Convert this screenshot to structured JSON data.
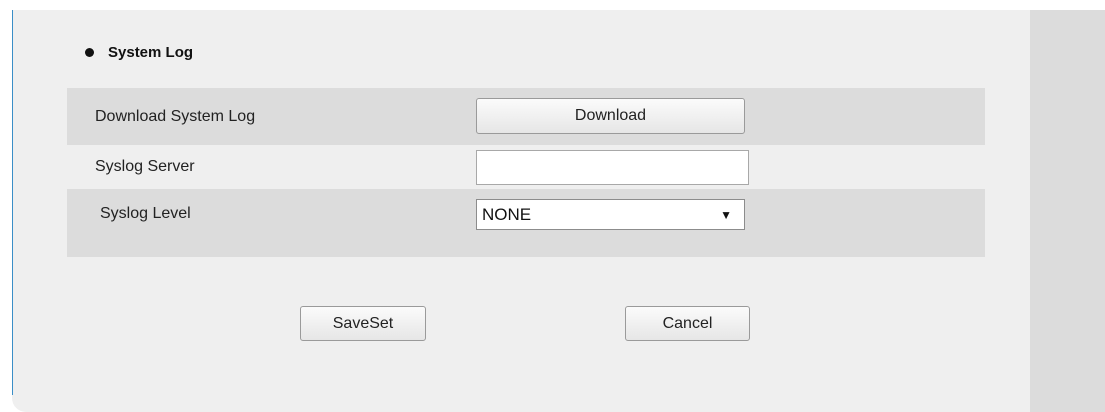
{
  "section": {
    "title": "System Log"
  },
  "rows": {
    "download": {
      "label": "Download System Log",
      "button_label": "Download"
    },
    "server": {
      "label": "Syslog Server",
      "value": ""
    },
    "level": {
      "label": "Syslog Level",
      "selected": "NONE"
    }
  },
  "actions": {
    "save_label": "SaveSet",
    "cancel_label": "Cancel"
  },
  "icons": {
    "dropdown": "dropdown-arrow-icon",
    "bullet": "bullet-icon"
  },
  "colors": {
    "panel_bg": "#efefef",
    "row_shade": "#dcdcdc",
    "side_bar": "#dcdcdc",
    "accent_rule": "#3a8ec7"
  }
}
